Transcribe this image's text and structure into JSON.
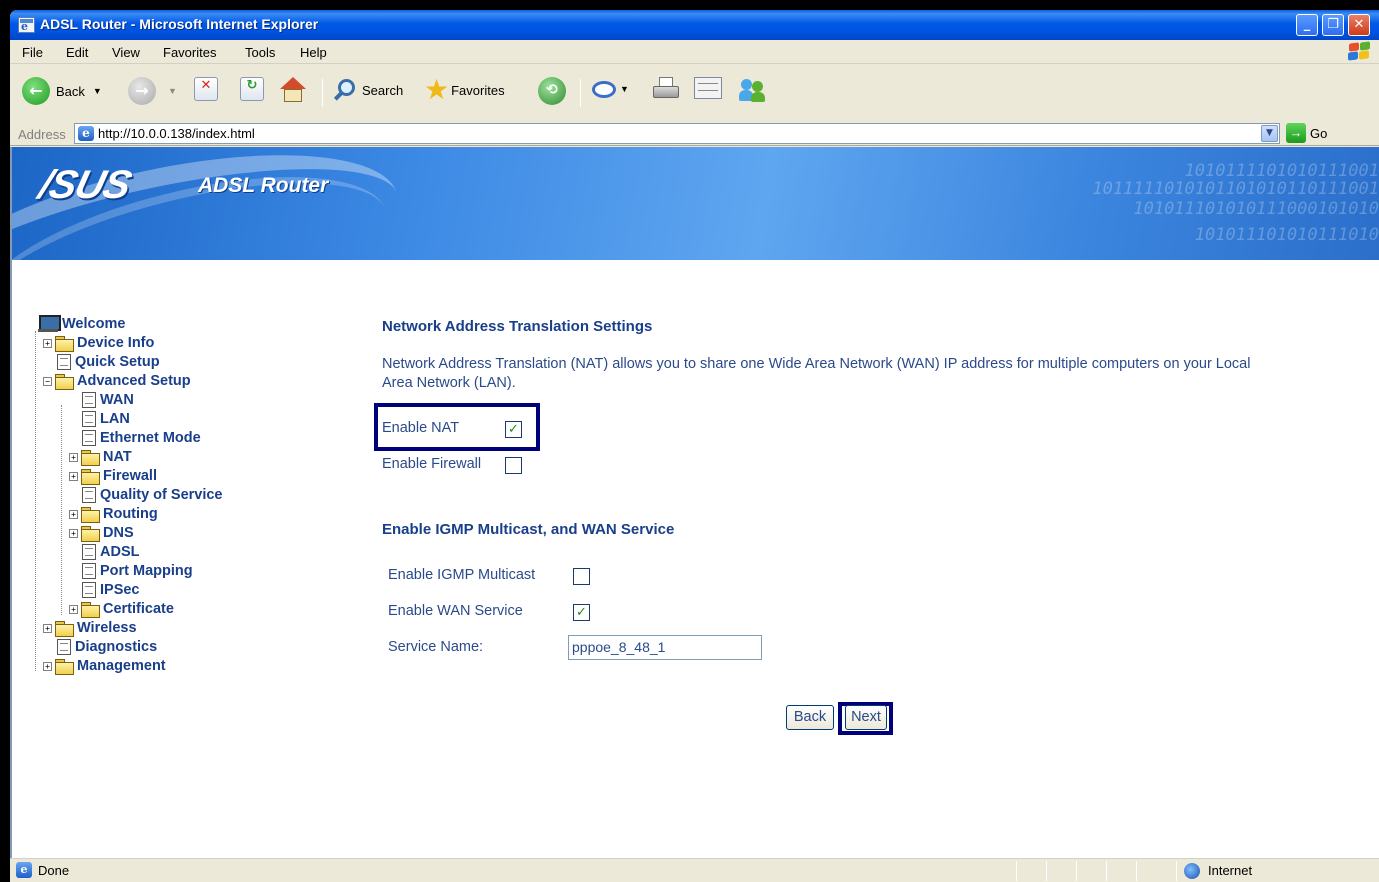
{
  "window": {
    "title": "ADSL Router - Microsoft Internet Explorer"
  },
  "menu": [
    "File",
    "Edit",
    "View",
    "Favorites",
    "Tools",
    "Help"
  ],
  "toolbar": {
    "back": "Back",
    "search": "Search",
    "favorites": "Favorites"
  },
  "address": {
    "label": "Address",
    "url": "http://10.0.0.138/index.html",
    "go": "Go"
  },
  "banner": {
    "logo": "/SUS",
    "product": "ADSL Router"
  },
  "tree": {
    "welcome": "Welcome",
    "device_info": "Device Info",
    "quick_setup": "Quick Setup",
    "advanced_setup": "Advanced Setup",
    "wan": "WAN",
    "lan": "LAN",
    "ethernet_mode": "Ethernet Mode",
    "nat": "NAT",
    "firewall": "Firewall",
    "qos": "Quality of Service",
    "routing": "Routing",
    "dns": "DNS",
    "adsl": "ADSL",
    "port_mapping": "Port Mapping",
    "ipsec": "IPSec",
    "certificate": "Certificate",
    "wireless": "Wireless",
    "diagnostics": "Diagnostics",
    "management": "Management"
  },
  "nat_section": {
    "title": "Network Address Translation Settings",
    "description": "Network Address Translation (NAT) allows you to share one Wide Area Network (WAN) IP address for multiple computers on your Local Area Network (LAN).",
    "enable_nat": "Enable NAT",
    "enable_nat_checked": true,
    "enable_firewall": "Enable Firewall",
    "enable_firewall_checked": false
  },
  "igmp_section": {
    "title": "Enable IGMP Multicast, and WAN Service",
    "enable_igmp": "Enable IGMP Multicast",
    "enable_igmp_checked": false,
    "enable_wan": "Enable WAN Service",
    "enable_wan_checked": true,
    "service_name_label": "Service Name:",
    "service_name_value": "pppoe_8_48_1"
  },
  "buttons": {
    "back": "Back",
    "next": "Next"
  },
  "status": {
    "text": "Done",
    "zone": "Internet"
  },
  "colors": {
    "highlight": "#00007a",
    "link": "#1a3f8a",
    "text": "#2b4a8a"
  }
}
